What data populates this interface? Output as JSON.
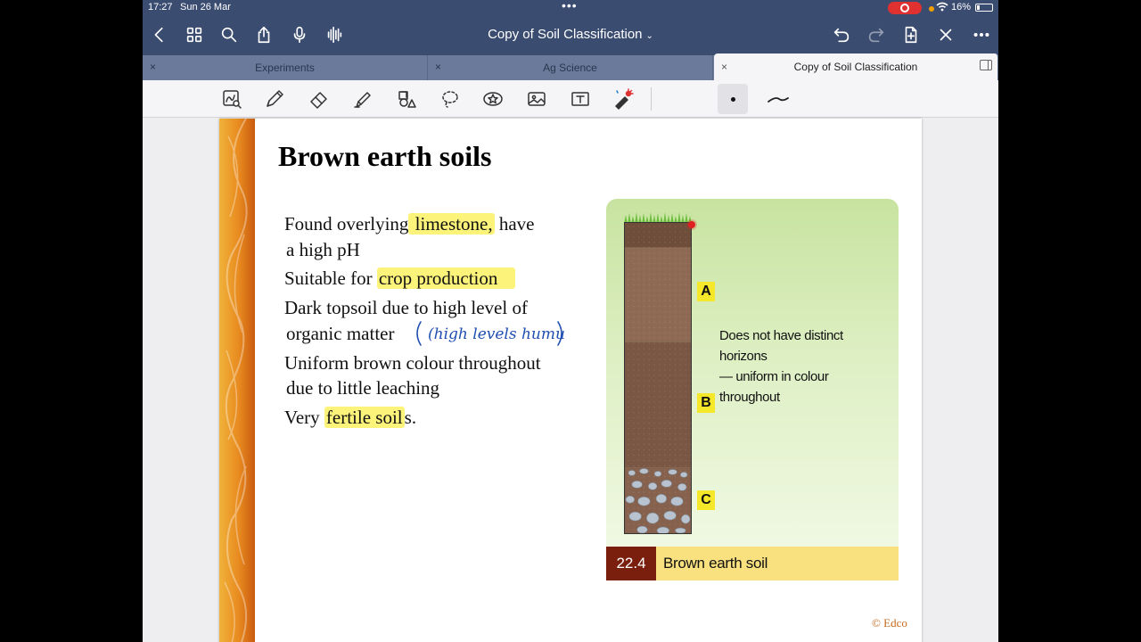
{
  "status_bar": {
    "time": "17:27",
    "date": "Sun 26 Mar",
    "battery": "16%"
  },
  "nav": {
    "title": "Copy of Soil Classification",
    "title_chevron": "⌄"
  },
  "tabs": [
    {
      "label": "Experiments",
      "close": "×"
    },
    {
      "label": "Ag Science",
      "close": "×"
    },
    {
      "label": "Copy of Soil Classification",
      "close": "×",
      "active": true
    }
  ],
  "slide": {
    "title": "Brown earth soils",
    "bullets": {
      "b1_pre": "Found overlying",
      "b1_hl": " limestone,",
      "b1_post": " have",
      "b1_line2": "a high pH",
      "b2_pre": "Suitable for ",
      "b2_hl": "crop production",
      "b3_line1": "Dark topsoil due to high level of",
      "b3_line2": "organic matter",
      "b4_line1": "Uniform brown colour throughout",
      "b4_line2": "due to little leaching",
      "b5_pre": "Very ",
      "b5_hl": "fertile soil",
      "b5_post": "s."
    },
    "handwritten_note": "(high levels humus)",
    "figure": {
      "horizons": [
        "A",
        "B",
        "C"
      ],
      "note_line1": "Does not have distinct horizons",
      "note_line2": "— uniform in colour throughout",
      "number": "22.4",
      "caption": "Brown earth soil"
    },
    "copyright": "© Edco"
  },
  "colors": {
    "nav_bg": "#3b4c71",
    "highlight": "#fbf37a",
    "ink": "#1f4fb0"
  }
}
